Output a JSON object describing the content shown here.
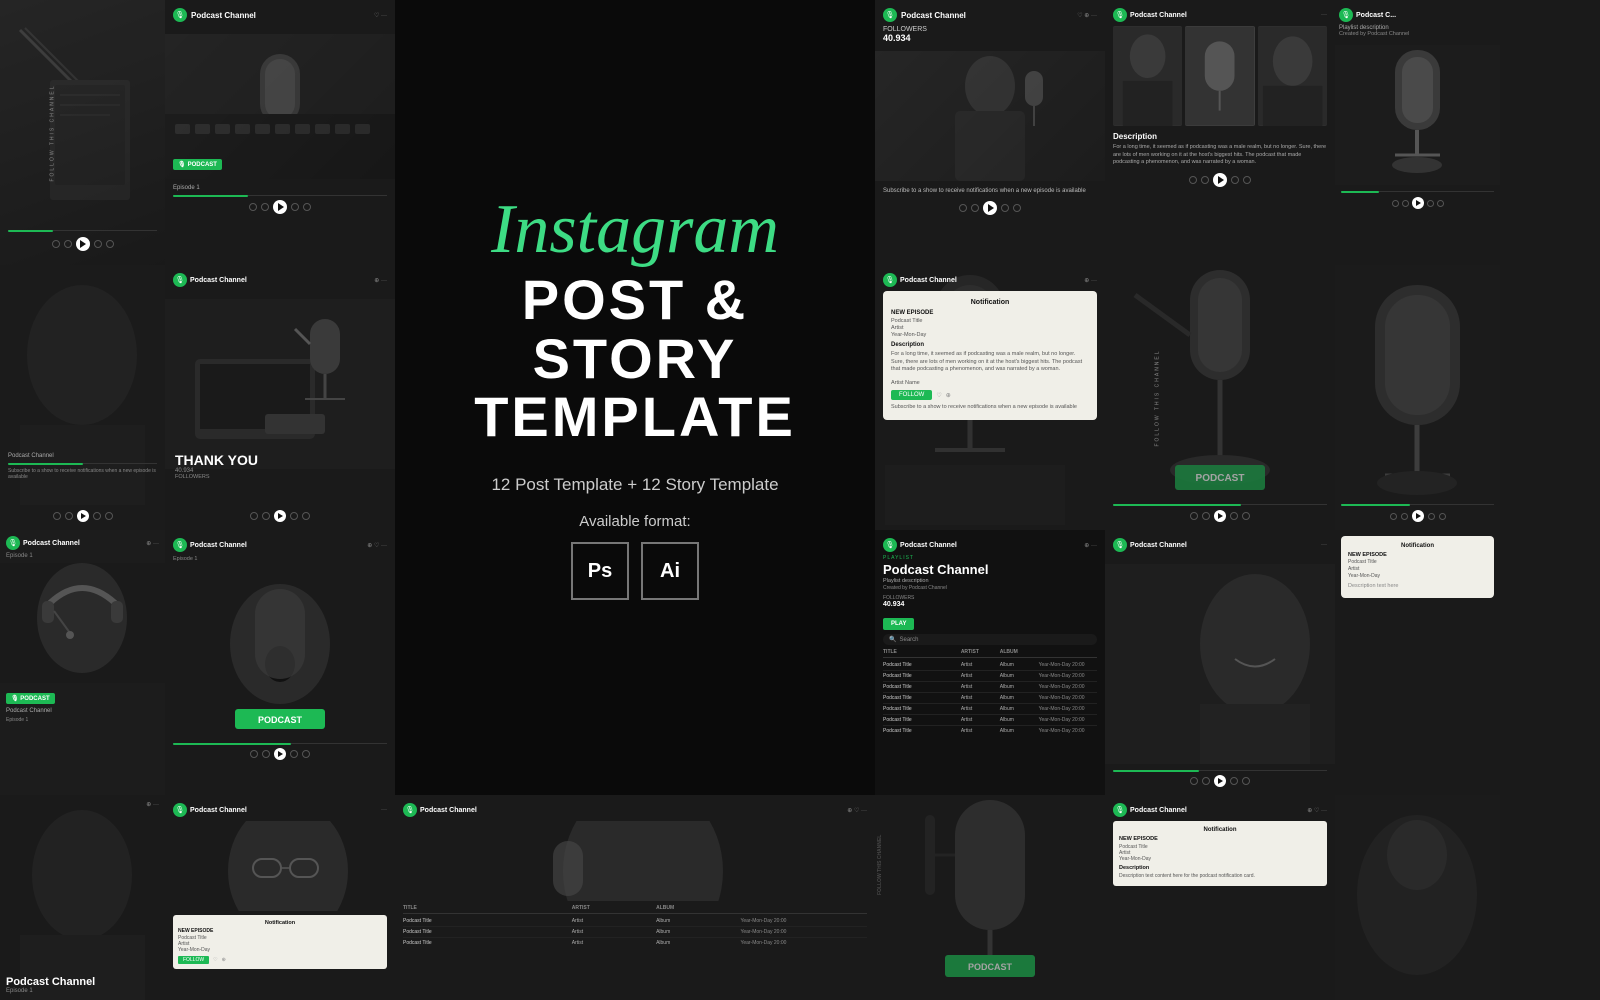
{
  "hero": {
    "instagram_label": "Instagram",
    "post_story_label": "POST & STORY",
    "template_label": "TEMPLATE",
    "subtitle": "12 Post Template + 12 Story Template",
    "format_label": "Available format:",
    "format_ps": "Ps",
    "format_ai": "Ai"
  },
  "colors": {
    "green": "#1db954",
    "dark_bg": "#0a0a0a",
    "card_bg": "#1c1c1c",
    "white": "#ffffff",
    "gray": "#888888"
  },
  "cards": {
    "podcast_channel": "Podcast Channel",
    "playlist_desc": "Playlist description",
    "created_by": "Created by Podcast Channel",
    "play": "PLAY",
    "new_episode": "NEW EPISODE",
    "podcast_title": "Podcast Title",
    "artist": "Artist",
    "album": "Album",
    "thank_you": "Thank You",
    "description": "Description",
    "notification": "Notification",
    "follow": "FOLLOW",
    "subscribe_text": "Subscribe to a show to receive notifications when a new episode is available",
    "follow_channel": "FOLLOW THIS CHANNEL",
    "search_placeholder": "Search",
    "table_headers": [
      "TITLE",
      "ARTIST",
      "ALBUM",
      ""
    ],
    "table_rows": [
      [
        "Podcast Title",
        "Artist",
        "Album",
        "Year-Mon-Day  20:00"
      ],
      [
        "Podcast Title",
        "Artist",
        "Album",
        "Year-Mon-Day  20:00"
      ],
      [
        "Podcast Title",
        "Artist",
        "Album",
        "Year-Mon-Day  20:00"
      ],
      [
        "Podcast Title",
        "Artist",
        "Album",
        "Year-Mon-Day  20:00"
      ],
      [
        "Podcast Title",
        "Artist",
        "Album",
        "Year-Mon-Day  20:00"
      ],
      [
        "Podcast Title",
        "Artist",
        "Album",
        "Year-Mon-Day  20:00"
      ],
      [
        "Podcast Title",
        "Artist",
        "Album",
        "Year-Mon-Day  20:00"
      ]
    ],
    "followers_label": "FOLLOWERS",
    "followers_count": "40.934",
    "episode_label": "Episode 1",
    "artist_name": "Artist Name",
    "podcast_label": "PODCAST"
  }
}
